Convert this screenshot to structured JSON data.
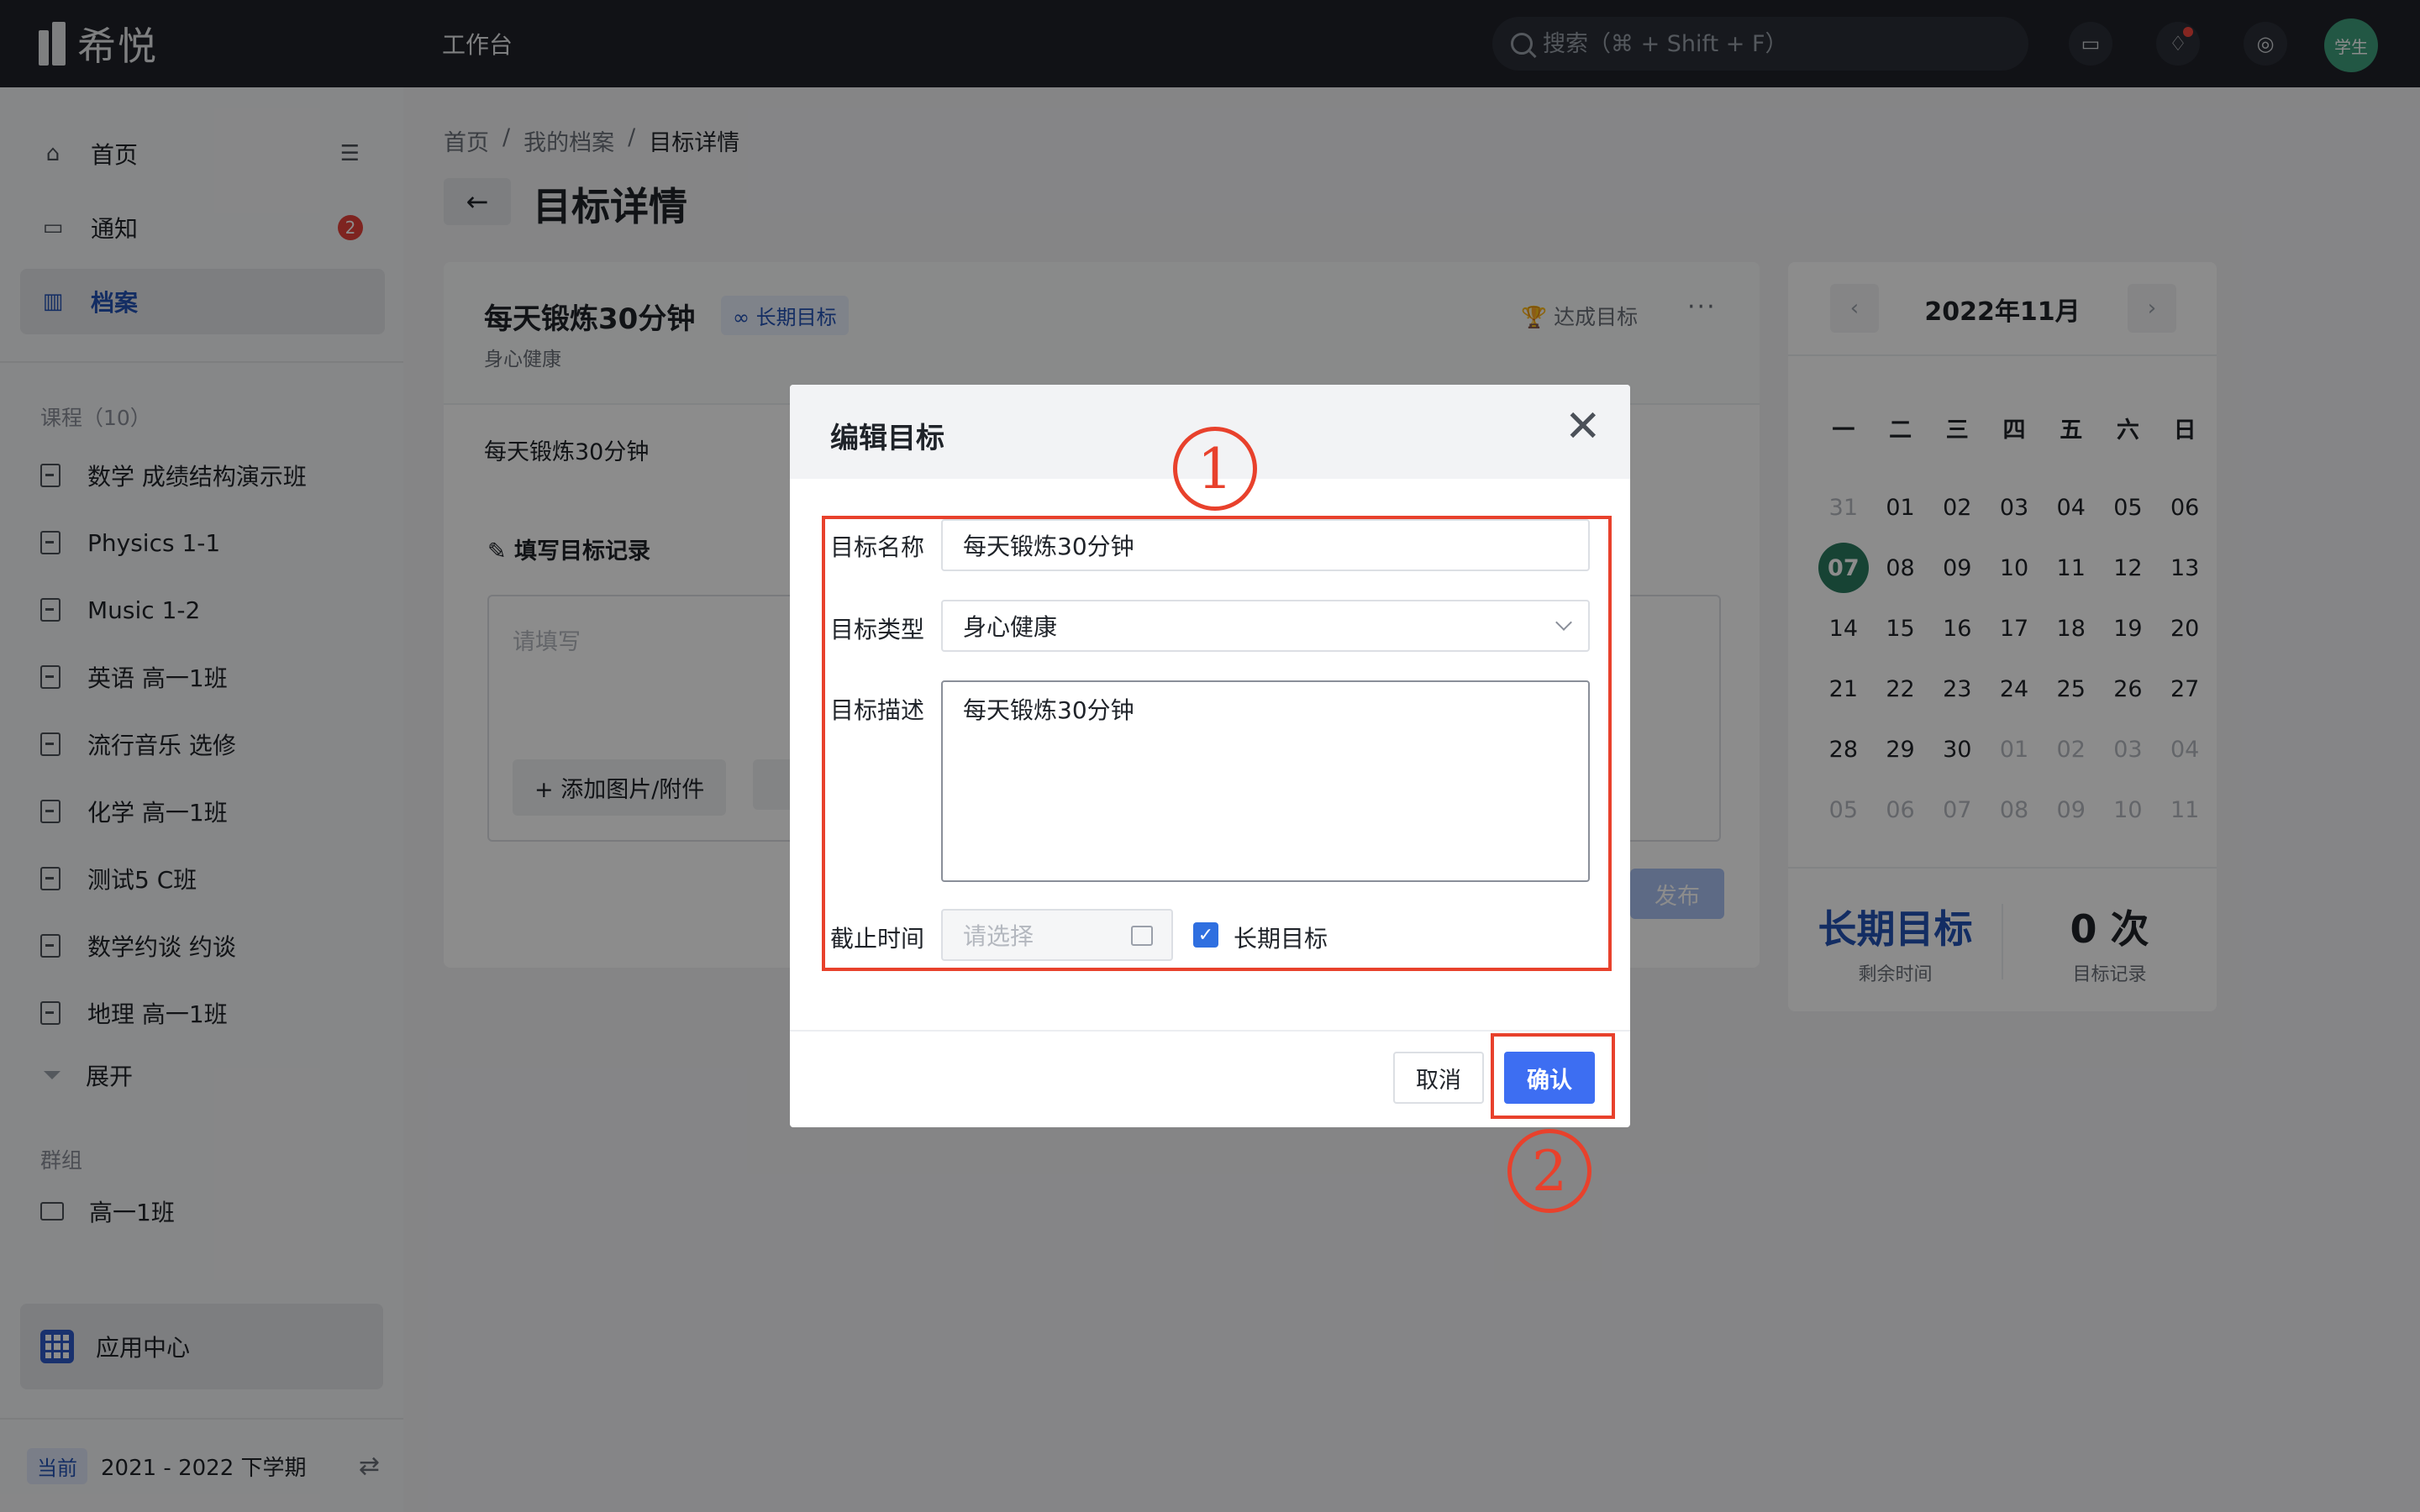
{
  "app": {
    "logo_text": "希悦",
    "workbench": "工作台"
  },
  "search": {
    "placeholder": "搜索（⌘ + Shift + F）"
  },
  "avatar": {
    "label": "学生"
  },
  "sidebar": {
    "home": "首页",
    "notice": "通知",
    "notice_badge": "2",
    "archive": "档案",
    "courses_title": "课程（10）",
    "courses": [
      "数学 成绩结构演示班",
      "Physics 1-1",
      "Music 1-2",
      "英语 高一1班",
      "流行音乐 选修",
      "化学 高一1班",
      "测试5 C班",
      "数学约谈 约谈",
      "地理 高一1班"
    ],
    "expand": "展开",
    "groups_title": "群组",
    "group": "高一1班",
    "app_center": "应用中心",
    "term_badge": "当前",
    "term": "2021 - 2022 下学期"
  },
  "breadcrumb": {
    "home": "首页",
    "archive": "我的档案",
    "current": "目标详情",
    "sep": "/"
  },
  "page": {
    "title": "目标详情"
  },
  "goal": {
    "name": "每天锻炼30分钟",
    "tag": "∞ 长期目标",
    "category": "身心健康",
    "achieve": "🏆 达成目标",
    "more": "···",
    "description": "每天锻炼30分钟",
    "record_title": "✎  填写目标记录",
    "record_placeholder": "请填写",
    "attach": "+ 添加图片/附件",
    "publish": "发布"
  },
  "calendar": {
    "title": "2022年11月",
    "prev": "‹",
    "next": "›",
    "weekdays": [
      "一",
      "二",
      "三",
      "四",
      "五",
      "六",
      "日"
    ],
    "days": [
      "31",
      "01",
      "02",
      "03",
      "04",
      "05",
      "06",
      "07",
      "08",
      "09",
      "10",
      "11",
      "12",
      "13",
      "14",
      "15",
      "16",
      "17",
      "18",
      "19",
      "20",
      "21",
      "22",
      "23",
      "24",
      "25",
      "26",
      "27",
      "28",
      "29",
      "30",
      "01",
      "02",
      "03",
      "04",
      "05",
      "06",
      "07",
      "08",
      "09",
      "10",
      "11"
    ],
    "long_term": "长期目标",
    "remaining": "剩余时间",
    "count": "0 次",
    "record": "目标记录"
  },
  "modal": {
    "title": "编辑目标",
    "close": "✕",
    "name_label": "目标名称",
    "name_value": "每天锻炼30分钟",
    "type_label": "目标类型",
    "type_value": "身心健康",
    "desc_label": "目标描述",
    "desc_value": "每天锻炼30分钟",
    "deadline_label": "截止时间",
    "deadline_placeholder": "请选择",
    "long_term_label": "长期目标",
    "cancel": "取消",
    "confirm": "确认"
  },
  "annotations": {
    "one": "1",
    "two": "2"
  },
  "colors": {
    "accent": "#3d6ef2",
    "annotation": "#e8412c",
    "today": "#2b7a60"
  }
}
